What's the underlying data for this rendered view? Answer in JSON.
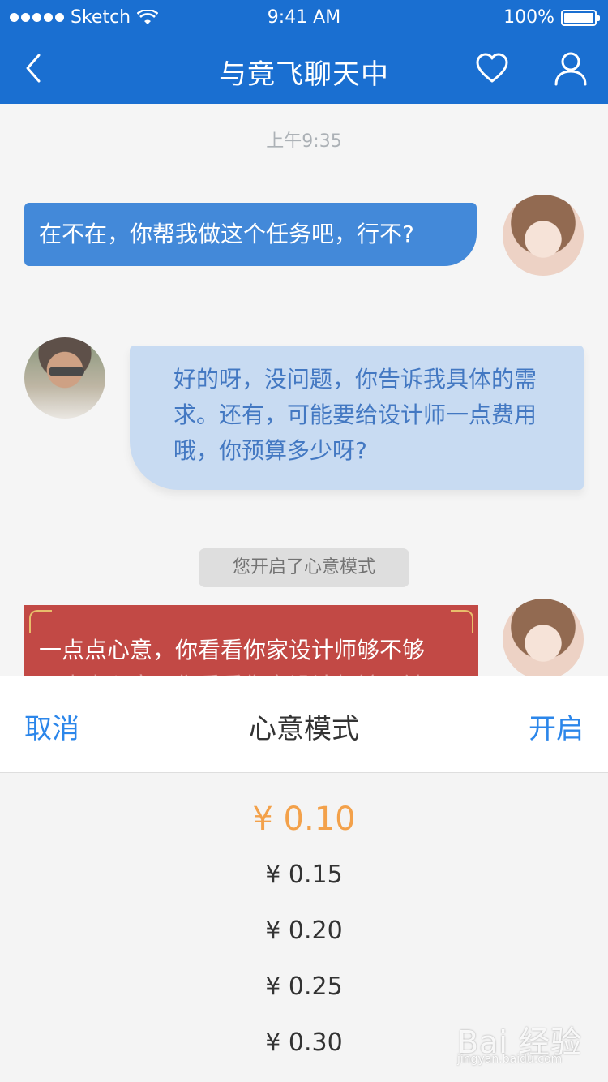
{
  "status": {
    "carrier": "Sketch",
    "time": "9:41 AM",
    "battery": "100%"
  },
  "nav": {
    "title": "与竟飞聊天中"
  },
  "chat": {
    "timestamp": "上午9:35",
    "messages": [
      {
        "text": "在不在，你帮我做这个任务吧，行不?"
      },
      {
        "line1": "好的呀，没问题，你告诉我具体的需",
        "line2": "求。还有，可能要给设计师一点费用",
        "line3": "哦，你预算多少呀?"
      },
      {
        "text": "一点点心意，你看看你家设计师够不够",
        "ghost": "一点点心意，你看看你家设计师够不够"
      }
    ],
    "system_notice": "您开启了心意模式"
  },
  "sheet": {
    "cancel_label": "取消",
    "title": "心意模式",
    "confirm_label": "开启",
    "options": [
      "¥ 0.10",
      "¥ 0.15",
      "¥ 0.20",
      "¥ 0.25",
      "¥ 0.30"
    ],
    "selected_index": 0
  },
  "colors": {
    "primary": "#1a6fd1",
    "accent": "#2b86ea",
    "selected": "#f3a14a",
    "gift": "#b5221d"
  },
  "watermark": {
    "line1": "Bai 经验",
    "line2": "jingyan.baidu.com"
  }
}
